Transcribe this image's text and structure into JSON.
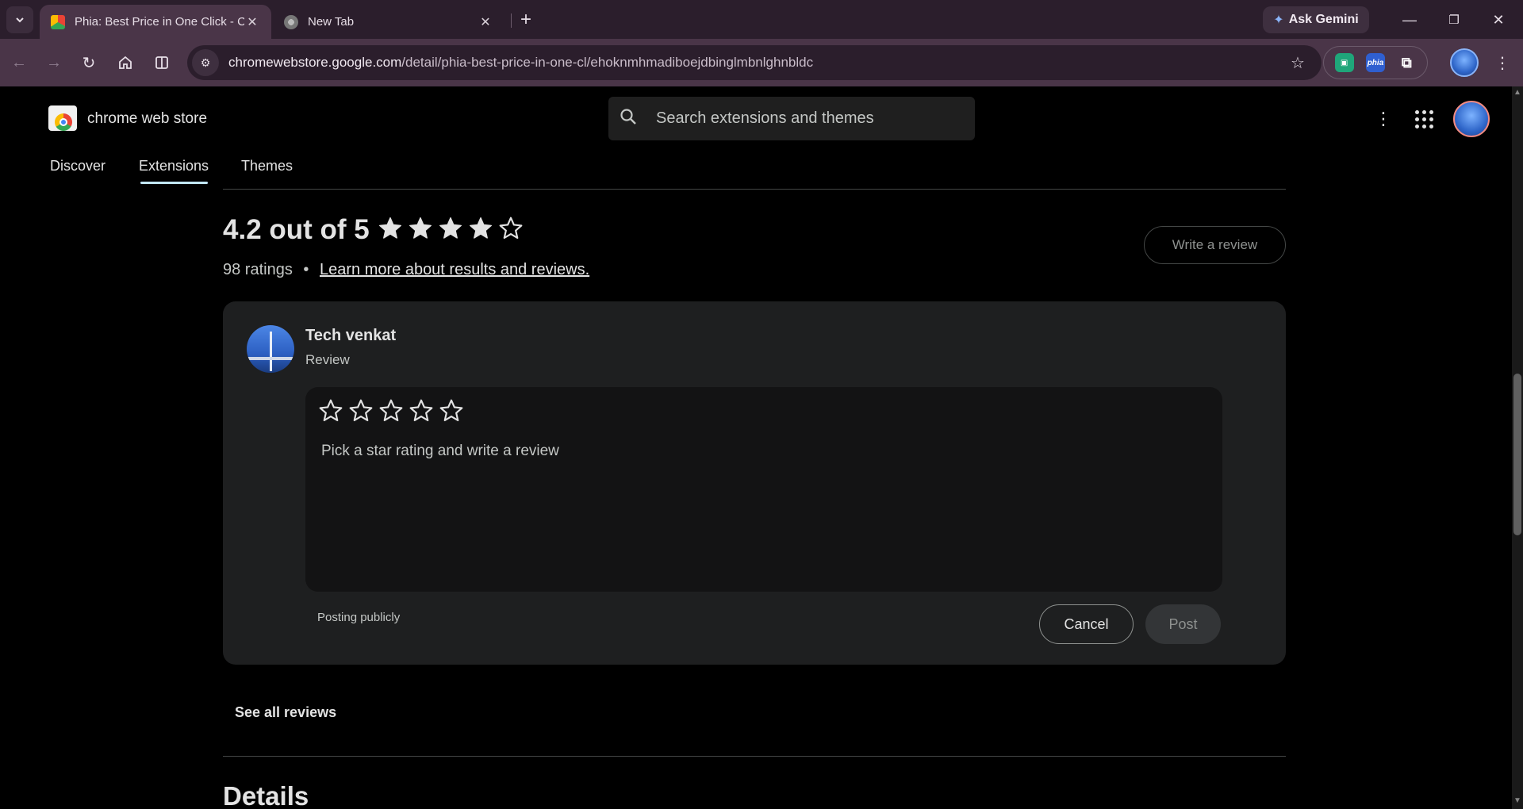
{
  "browser": {
    "tabs": [
      {
        "title": "Phia: Best Price in One Click - Chrome Web Store",
        "active": true
      },
      {
        "title": "New Tab",
        "active": false
      }
    ],
    "ask_gemini": "Ask Gemini",
    "url_host": "chromewebstore.google.com",
    "url_path": "/detail/phia-best-price-in-one-cl/ehoknmhmadiboejdbinglmbnlghnbldc",
    "extensions": [
      "green-extension",
      "phia",
      "puzzle"
    ]
  },
  "header": {
    "store_name": "chrome web store",
    "search_placeholder": "Search extensions and themes",
    "nav": [
      "Discover",
      "Extensions",
      "Themes"
    ],
    "active_nav": "Extensions"
  },
  "ratings": {
    "title": "4.2 out of 5",
    "average": 4.2,
    "max": 5,
    "count_label": "98 ratings",
    "separator": "•",
    "learn_more": "Learn more about results and reviews.",
    "write_review": "Write a review"
  },
  "review_form": {
    "reviewer": "Tech venkat",
    "label": "Review",
    "star_count": 5,
    "placeholder": "Pick a star rating and write a review",
    "posting_note": "Posting publicly",
    "cancel": "Cancel",
    "post": "Post"
  },
  "see_all": "See all reviews",
  "details_heading": "Details",
  "colors": {
    "tab_strip": "#2b1e2c",
    "toolbar": "#4a3548",
    "page_bg": "#000000",
    "card_bg": "#1e1f20",
    "accent": "#c2e7ff"
  }
}
